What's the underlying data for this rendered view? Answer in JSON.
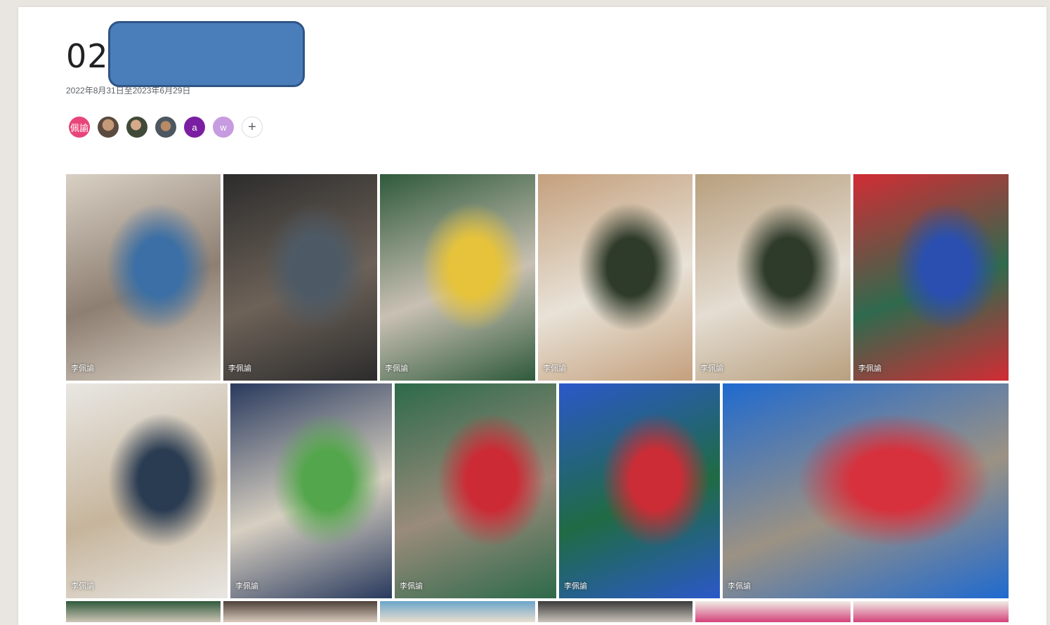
{
  "album": {
    "title": "02",
    "date_range": "2022年8月31日至2023年6月29日"
  },
  "members": [
    {
      "type": "initials",
      "label": "佩諭",
      "color": "#e8457a"
    },
    {
      "type": "photo",
      "label": ""
    },
    {
      "type": "photo",
      "label": ""
    },
    {
      "type": "photo",
      "label": ""
    },
    {
      "type": "initials",
      "label": "a",
      "color": "#7b1fa2"
    },
    {
      "type": "initials",
      "label": "w",
      "color": "#c79be0"
    }
  ],
  "add_member_label": "+",
  "photos": [
    {
      "owner": "李佩諭",
      "colors": [
        "#8d7f72",
        "#d9d0c4",
        "#3b6fa5"
      ]
    },
    {
      "owner": "李佩諭",
      "colors": [
        "#6d6258",
        "#2c2c2c",
        "#4d5a66"
      ]
    },
    {
      "owner": "李佩諭",
      "colors": [
        "#c9c0b3",
        "#2f5a3c",
        "#e6c33a"
      ]
    },
    {
      "owner": "李佩諭",
      "colors": [
        "#e8e2d7",
        "#c4a07d",
        "#2f3b2a"
      ]
    },
    {
      "owner": "李佩諭",
      "colors": [
        "#e4ddd2",
        "#b89f7e",
        "#2e3a2a"
      ]
    },
    {
      "owner": "李佩諭",
      "colors": [
        "#2f6a4e",
        "#d22c34",
        "#2a4fb0"
      ]
    },
    {
      "owner": "李佩諭",
      "colors": [
        "#c6b59c",
        "#e9e7e3",
        "#2a3c52"
      ]
    },
    {
      "owner": "李佩諭",
      "colors": [
        "#d7cfc1",
        "#293a5e",
        "#54a64c"
      ]
    },
    {
      "owner": "李佩諭",
      "colors": [
        "#9a8b7b",
        "#2d6a4a",
        "#cc2a35"
      ]
    },
    {
      "owner": "李佩諭",
      "colors": [
        "#1f6b44",
        "#2b58c9",
        "#cc2c36"
      ]
    },
    {
      "owner": "李佩諭",
      "colors": [
        "#9c9283",
        "#1f6acf",
        "#d6313d"
      ]
    },
    {
      "owner": "",
      "colors": [
        "#2f5a3c",
        "#cfc6b6"
      ]
    },
    {
      "owner": "",
      "colors": [
        "#4d4038",
        "#d9cbbd"
      ]
    },
    {
      "owner": "",
      "colors": [
        "#6ca5c9",
        "#e8dfd0"
      ]
    },
    {
      "owner": "",
      "colors": [
        "#3a3a3a",
        "#c9c3ba"
      ]
    },
    {
      "owner": "",
      "colors": [
        "#f0ece6",
        "#d4437a"
      ]
    },
    {
      "owner": "",
      "colors": [
        "#f0ece6",
        "#d4437a"
      ]
    }
  ]
}
